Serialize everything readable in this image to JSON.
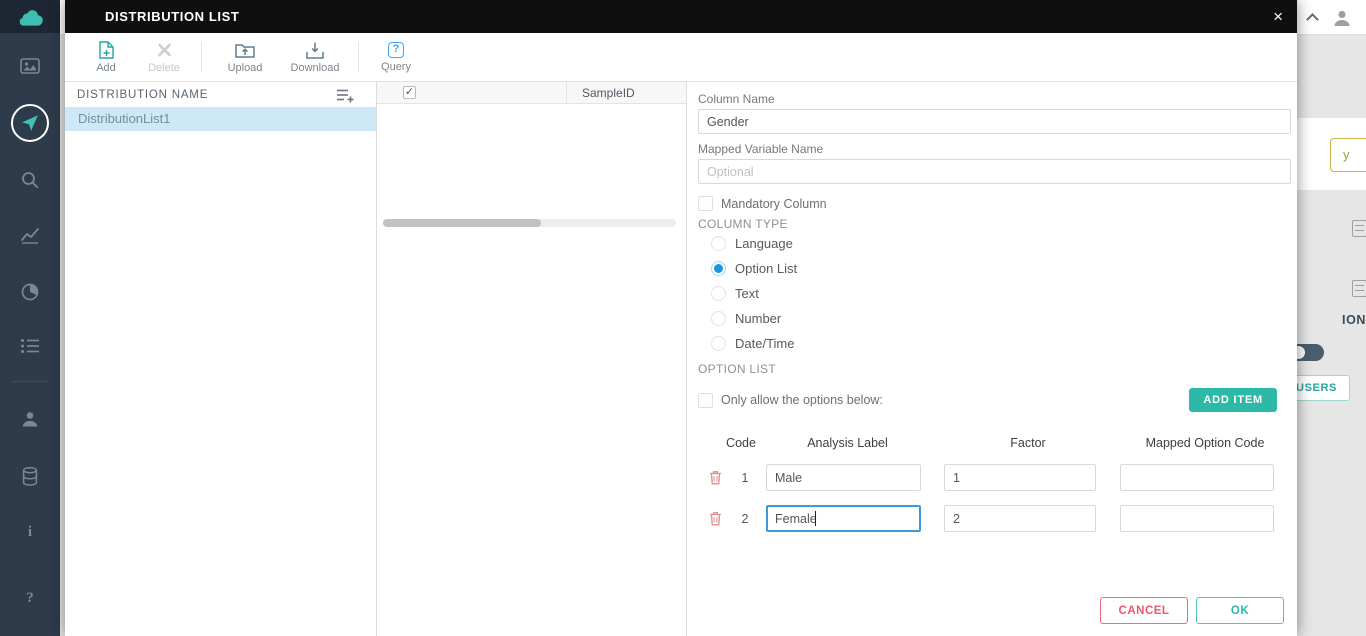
{
  "icons": {
    "close": "×",
    "check": "✓",
    "info": "i",
    "question": "?"
  },
  "modal": {
    "title": "DISTRIBUTION LIST",
    "toolbar": {
      "add": {
        "label": "Add"
      },
      "delete": {
        "label": "Delete"
      },
      "upload": {
        "label": "Upload"
      },
      "download": {
        "label": "Download"
      },
      "query": {
        "label": "Query"
      }
    },
    "list_panel": {
      "header": "DISTRIBUTION NAME",
      "items": [
        {
          "label": "DistributionList1",
          "selected": true
        }
      ]
    },
    "grid_panel": {
      "columns": [
        "SampleID"
      ],
      "select_all_checked": true
    },
    "form": {
      "column_name_label": "Column Name",
      "column_name_value": "Gender",
      "mapped_variable_label": "Mapped Variable Name",
      "mapped_variable_placeholder": "Optional",
      "mandatory_label": "Mandatory Column",
      "mandatory_checked": false,
      "column_type_label": "COLUMN TYPE",
      "column_types": [
        {
          "label": "Language",
          "selected": false
        },
        {
          "label": "Option List",
          "selected": true
        },
        {
          "label": "Text",
          "selected": false
        },
        {
          "label": "Number",
          "selected": false
        },
        {
          "label": "Date/Time",
          "selected": false
        }
      ],
      "option_list_label": "OPTION LIST",
      "only_allow_label": "Only allow the options below:",
      "only_allow_checked": false,
      "add_item_label": "ADD ITEM",
      "options_table": {
        "headers": [
          "Code",
          "Analysis Label",
          "Factor",
          "Mapped Option Code"
        ],
        "rows": [
          {
            "code": "1",
            "analysis_label": "Male",
            "factor": "1",
            "mapped_option_code": ""
          },
          {
            "code": "2",
            "analysis_label": "Female",
            "factor": "2",
            "mapped_option_code": "",
            "focused": true
          }
        ]
      },
      "cancel_label": "CANCEL",
      "ok_label": "OK"
    }
  },
  "background": {
    "partial_button_text": "y",
    "partial_heading": "ION",
    "users_button_label": "USERS"
  },
  "colors": {
    "accent_teal": "#2cb9a8",
    "accent_blue": "#1798e5",
    "danger": "#f0566e",
    "selection": "#cde8f6",
    "modal_header": "#0f0f0f",
    "sidebar": "#2d3b4a"
  }
}
